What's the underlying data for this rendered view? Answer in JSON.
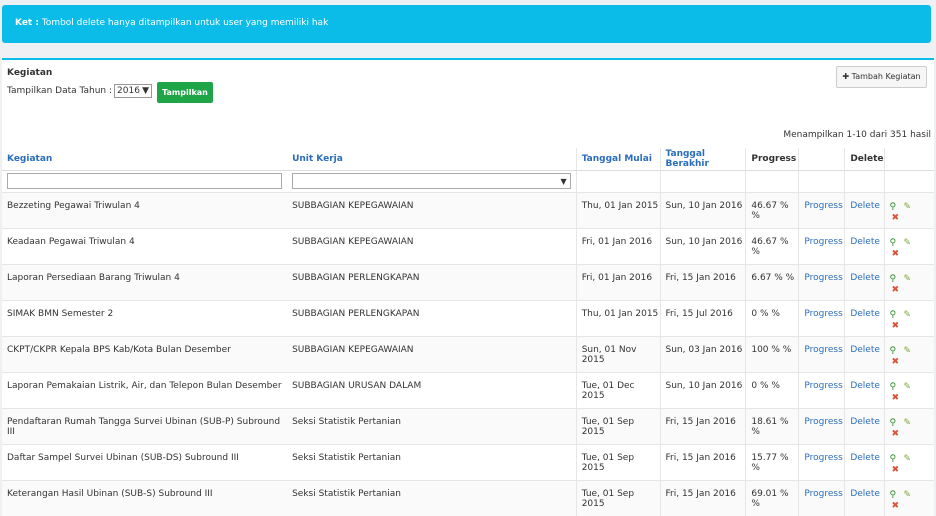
{
  "alert": {
    "label": "Ket :",
    "text": "Tombol delete hanya ditampilkan untuk user yang memiliki hak"
  },
  "panel": {
    "title": "Kegiatan",
    "year_label": "Tampilkan Data Tahun :",
    "year_value": "2016",
    "show_button": "Tampilkan",
    "add_button": "Tambah Kegiatan",
    "summary": "Menampilkan 1-10 dari 351 hasil"
  },
  "table": {
    "headers": [
      "Kegiatan",
      "Unit Kerja",
      "Tanggal Mulai",
      "Tanggal Berakhir",
      "Progress",
      "",
      "Delete"
    ],
    "rows": [
      {
        "kegiatan": "Bezzeting Pegawai Triwulan 4",
        "unit": "SUBBAGIAN KEPEGAWAIAN",
        "mulai": "Thu, 01 Jan 2015",
        "akhir": "Sun, 10 Jan 2016",
        "progress": "46.67 % %",
        "progress_link": "Progress",
        "delete": "Delete"
      },
      {
        "kegiatan": "Keadaan Pegawai Triwulan 4",
        "unit": "SUBBAGIAN KEPEGAWAIAN",
        "mulai": "Fri, 01 Jan 2016",
        "akhir": "Sun, 10 Jan 2016",
        "progress": "46.67 % %",
        "progress_link": "Progress",
        "delete": "Delete"
      },
      {
        "kegiatan": "Laporan Persediaan Barang Triwulan 4",
        "unit": "SUBBAGIAN PERLENGKAPAN",
        "mulai": "Fri, 01 Jan 2016",
        "akhir": "Fri, 15 Jan 2016",
        "progress": "6.67 % %",
        "progress_link": "Progress",
        "delete": "Delete"
      },
      {
        "kegiatan": "SIMAK BMN Semester 2",
        "unit": "SUBBAGIAN PERLENGKAPAN",
        "mulai": "Thu, 01 Jan 2015",
        "akhir": "Fri, 15 Jul 2016",
        "progress": "0 % %",
        "progress_link": "Progress",
        "delete": "Delete"
      },
      {
        "kegiatan": "CKPT/CKPR Kepala BPS Kab/Kota Bulan Desember",
        "unit": "SUBBAGIAN KEPEGAWAIAN",
        "mulai": "Sun, 01 Nov 2015",
        "akhir": "Sun, 03 Jan 2016",
        "progress": "100 % %",
        "progress_link": "Progress",
        "delete": "Delete"
      },
      {
        "kegiatan": "Laporan Pemakaian Listrik, Air, dan Telepon Bulan Desember",
        "unit": "SUBBAGIAN URUSAN DALAM",
        "mulai": "Tue, 01 Dec 2015",
        "akhir": "Sun, 10 Jan 2016",
        "progress": "0 % %",
        "progress_link": "Progress",
        "delete": "Delete"
      },
      {
        "kegiatan": "Pendaftaran Rumah Tangga Survei Ubinan (SUB-P) Subround III",
        "unit": "Seksi Statistik Pertanian",
        "mulai": "Tue, 01 Sep 2015",
        "akhir": "Fri, 15 Jan 2016",
        "progress": "18.61 % %",
        "progress_link": "Progress",
        "delete": "Delete"
      },
      {
        "kegiatan": "Daftar Sampel Survei Ubinan (SUB-DS) Subround III",
        "unit": "Seksi Statistik Pertanian",
        "mulai": "Tue, 01 Sep 2015",
        "akhir": "Fri, 15 Jan 2016",
        "progress": "15.77 % %",
        "progress_link": "Progress",
        "delete": "Delete"
      },
      {
        "kegiatan": "Keterangan Hasil Ubinan (SUB-S) Subround III",
        "unit": "Seksi Statistik Pertanian",
        "mulai": "Tue, 01 Sep 2015",
        "akhir": "Fri, 15 Jan 2016",
        "progress": "69.01 % %",
        "progress_link": "Progress",
        "delete": "Delete"
      }
    ]
  },
  "colors": {
    "accent": "#0bbbe8",
    "button_green": "#1fa448",
    "link": "#2a6ebb",
    "delete_icon": "#d9533a"
  }
}
